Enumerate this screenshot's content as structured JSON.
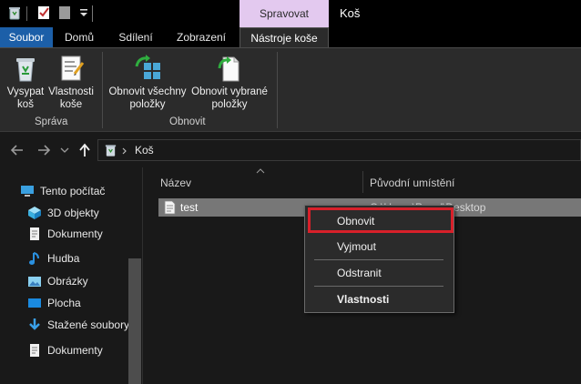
{
  "titlebar": {
    "manage_tab": "Spravovat",
    "window_title": "Koš",
    "quick_access_icons": [
      "recycle-bin-icon",
      "properties-check-icon",
      "new-folder-icon",
      "customize-dropdown-icon"
    ]
  },
  "ribbon_tabs": {
    "file": "Soubor",
    "home": "Domů",
    "share": "Sdílení",
    "view": "Zobrazení",
    "tools": "Nástroje koše"
  },
  "ribbon": {
    "groups": [
      {
        "label": "Správa",
        "buttons": [
          {
            "label": "Vysypat koš",
            "icon": "empty-recycle-bin-icon"
          },
          {
            "label": "Vlastnosti koše",
            "icon": "recycle-bin-properties-icon"
          }
        ]
      },
      {
        "label": "Obnovit",
        "buttons": [
          {
            "label": "Obnovit všechny položky",
            "icon": "restore-all-icon"
          },
          {
            "label": "Obnovit vybrané položky",
            "icon": "restore-selected-icon"
          }
        ]
      }
    ]
  },
  "addressbar": {
    "path": "Koš",
    "icons": [
      "back-arrow-icon",
      "forward-arrow-icon",
      "recent-dropdown-icon",
      "up-arrow-icon",
      "recycle-bin-icon"
    ]
  },
  "navpane": {
    "items": [
      {
        "label": "Tento počítač",
        "icon": "computer-icon"
      },
      {
        "label": "3D objekty",
        "icon": "cube-icon"
      },
      {
        "label": "Dokumenty",
        "icon": "document-icon"
      },
      {
        "label": "Hudba",
        "icon": "music-icon"
      },
      {
        "label": "Obrázky",
        "icon": "pictures-icon"
      },
      {
        "label": "Plocha",
        "icon": "desktop-icon"
      },
      {
        "label": "Stažené soubory",
        "icon": "download-icon"
      },
      {
        "label": "Dokumenty",
        "icon": "document-icon"
      }
    ]
  },
  "filelist": {
    "columns": [
      "Název",
      "Původní umístění"
    ],
    "rows": [
      {
        "name": "test",
        "location": "C:\\Users\\Pavel\\Desktop",
        "icon": "text-file-icon"
      }
    ]
  },
  "context_menu": {
    "items": [
      "Obnovit",
      "Vyjmout",
      "Odstranit",
      "Vlastnosti"
    ],
    "highlight_color": "#d8202a"
  },
  "colors": {
    "accent_file_tab": "#1c5fa8",
    "manage_tab": "#e3c9ef",
    "selection": "#777777"
  }
}
